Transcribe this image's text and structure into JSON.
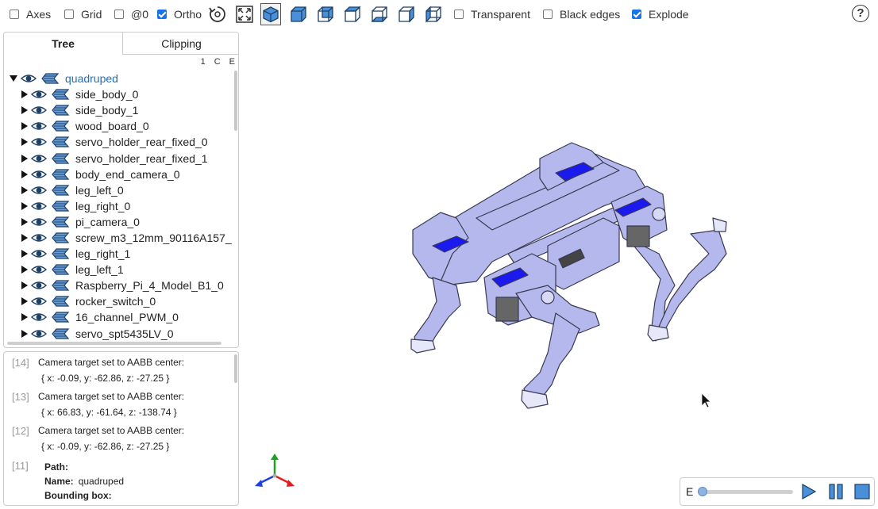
{
  "toolbar": {
    "axes": {
      "label": "Axes",
      "checked": false
    },
    "grid": {
      "label": "Grid",
      "checked": false
    },
    "at0": {
      "label": "@0",
      "checked": false
    },
    "ortho": {
      "label": "Ortho",
      "checked": true
    },
    "transparent": {
      "label": "Transparent",
      "checked": false
    },
    "black_edges": {
      "label": "Black edges",
      "checked": false
    },
    "explode": {
      "label": "Explode",
      "checked": true
    },
    "help_label": "?"
  },
  "tabs": {
    "tree": "Tree",
    "clipping": "Clipping"
  },
  "column_heads": [
    "1",
    "C",
    "E"
  ],
  "tree": {
    "root": "quadruped",
    "children": [
      "side_body_0",
      "side_body_1",
      "wood_board_0",
      "servo_holder_rear_fixed_0",
      "servo_holder_rear_fixed_1",
      "body_end_camera_0",
      "leg_left_0",
      "leg_right_0",
      "pi_camera_0",
      "screw_m3_12mm_90116A157_",
      "leg_right_1",
      "leg_left_1",
      "Raspberry_Pi_4_Model_B1_0",
      "rocker_switch_0",
      "16_channel_PWM_0",
      "servo_spt5435LV_0"
    ]
  },
  "log": [
    {
      "index": "[14]",
      "message": "Camera target set to AABB center:",
      "coords": "{ x: -0.09, y: -62.86, z: -27.25 }"
    },
    {
      "index": "[13]",
      "message": "Camera target set to AABB center:",
      "coords": "{ x: 66.83, y: -61.64, z: -138.74 }"
    },
    {
      "index": "[12]",
      "message": "Camera target set to AABB center:",
      "coords": "{ x: -0.09, y: -62.86, z: -27.25 }"
    }
  ],
  "info": {
    "index": "[11]",
    "path_label": "Path:",
    "name_label": "Name:",
    "name_value": "quadruped",
    "bbox_label": "Bounding box:"
  },
  "player": {
    "label": "E",
    "progress": 0
  },
  "colors": {
    "accent": "#1a73e8",
    "model_fill": "#b4b8ec",
    "model_highlight": "#1a1aee",
    "toolbar_icon": "#4a90d9"
  }
}
